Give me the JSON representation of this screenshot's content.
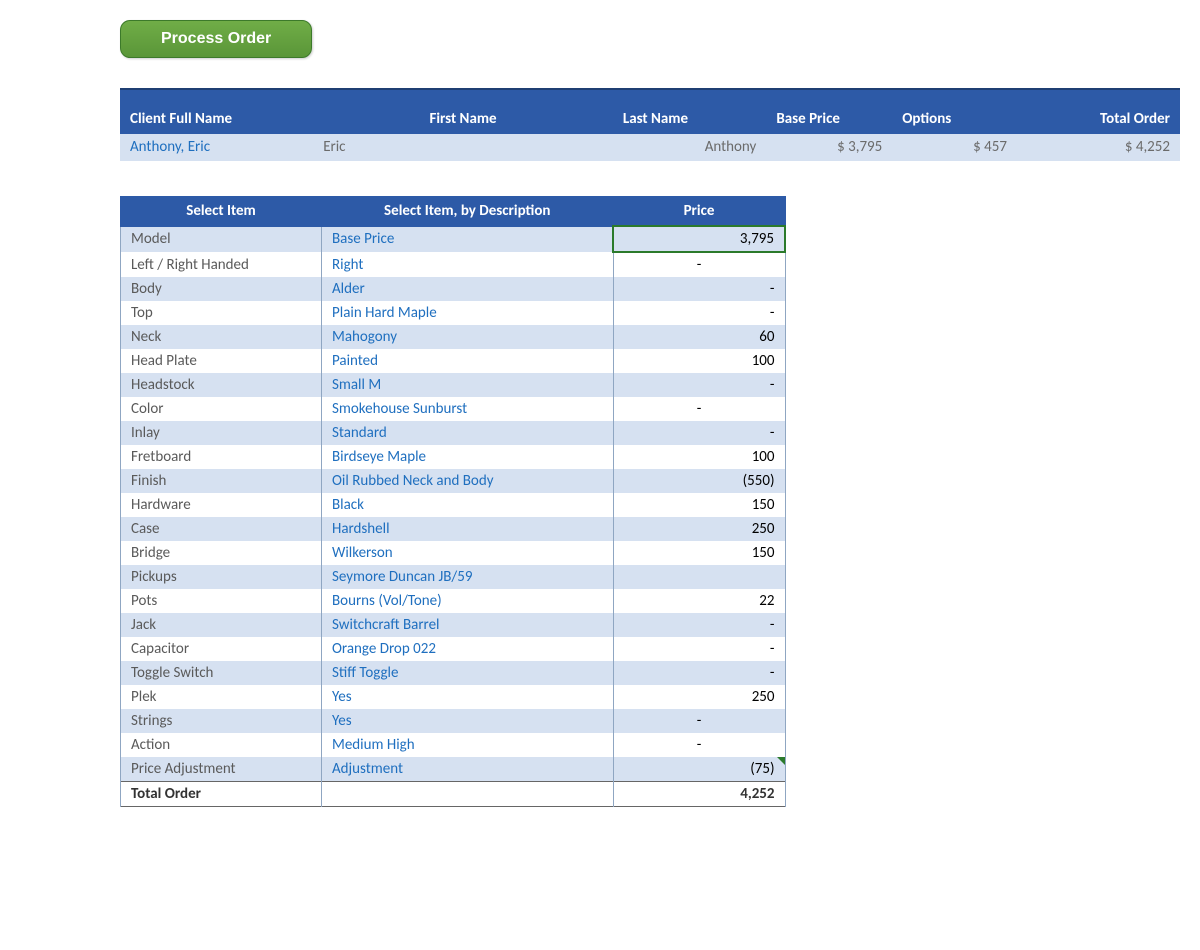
{
  "button": {
    "process": "Process Order"
  },
  "client_headers": {
    "full": "Client Full Name",
    "first": "First Name",
    "last": "Last Name",
    "base": "Base Price",
    "options": "Options",
    "total": "Total Order"
  },
  "client": {
    "full": "Anthony, Eric",
    "first": "Eric",
    "last": "Anthony",
    "base": "$   3,795",
    "options": "$              457",
    "total": "$              4,252"
  },
  "item_headers": {
    "col1": "Select Item",
    "col2": "Select Item, by Description",
    "col3": "Price"
  },
  "items": [
    {
      "cat": "Model",
      "desc": "Base Price",
      "price": "3,795",
      "align": "right",
      "selected": true
    },
    {
      "cat": "Left / Right Handed",
      "desc": "Right",
      "price": "-",
      "align": "center"
    },
    {
      "cat": "Body",
      "desc": "Alder",
      "price": "-",
      "align": "right"
    },
    {
      "cat": "Top",
      "desc": "Plain Hard Maple",
      "price": "-",
      "align": "right"
    },
    {
      "cat": "Neck",
      "desc": "Mahogony",
      "price": "60",
      "align": "right"
    },
    {
      "cat": "Head Plate",
      "desc": "Painted",
      "price": "100",
      "align": "right"
    },
    {
      "cat": "Headstock",
      "desc": "Small M",
      "price": "-",
      "align": "right"
    },
    {
      "cat": "Color",
      "desc": "Smokehouse Sunburst",
      "price": "-",
      "align": "center"
    },
    {
      "cat": "Inlay",
      "desc": "Standard",
      "price": "-",
      "align": "right"
    },
    {
      "cat": "Fretboard",
      "desc": "Birdseye Maple",
      "price": "100",
      "align": "right"
    },
    {
      "cat": "Finish",
      "desc": "Oil Rubbed Neck and Body",
      "price": "(550)",
      "align": "right"
    },
    {
      "cat": "Hardware",
      "desc": "Black",
      "price": "150",
      "align": "right"
    },
    {
      "cat": "Case",
      "desc": "Hardshell",
      "price": "250",
      "align": "right"
    },
    {
      "cat": "Bridge",
      "desc": "Wilkerson",
      "price": "150",
      "align": "right"
    },
    {
      "cat": "Pickups",
      "desc": "Seymore Duncan JB/59",
      "price": "",
      "align": "right"
    },
    {
      "cat": "Pots",
      "desc": "Bourns (Vol/Tone)",
      "price": "22",
      "align": "right"
    },
    {
      "cat": "Jack",
      "desc": "Switchcraft Barrel",
      "price": "-",
      "align": "right"
    },
    {
      "cat": "Capacitor",
      "desc": "Orange Drop 022",
      "price": "-",
      "align": "right"
    },
    {
      "cat": "Toggle Switch",
      "desc": "Stiff Toggle",
      "price": "-",
      "align": "right"
    },
    {
      "cat": "Plek",
      "desc": "Yes",
      "price": "250",
      "align": "right"
    },
    {
      "cat": "Strings",
      "desc": "Yes",
      "price": "-",
      "align": "center"
    },
    {
      "cat": "Action",
      "desc": "Medium High",
      "price": "-",
      "align": "center"
    },
    {
      "cat": "Price Adjustment",
      "desc": "Adjustment",
      "price": "(75)",
      "align": "right",
      "corner": true
    }
  ],
  "total_row": {
    "label": "Total Order",
    "value": "4,252"
  }
}
